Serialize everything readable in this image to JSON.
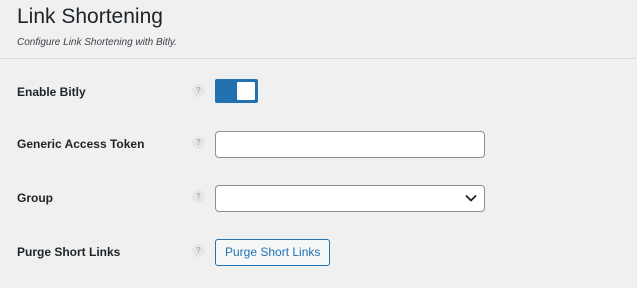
{
  "header": {
    "title": "Link Shortening",
    "description": "Configure Link Shortening with Bitly."
  },
  "help_glyph": "?",
  "settings": {
    "enable_bitly": {
      "label": "Enable Bitly",
      "enabled": true
    },
    "access_token": {
      "label": "Generic Access Token",
      "value": "",
      "placeholder": ""
    },
    "group": {
      "label": "Group",
      "selected": "",
      "icon": "chevron-down-icon"
    },
    "purge": {
      "label": "Purge Short Links",
      "button_label": "Purge Short Links"
    }
  },
  "colors": {
    "accent": "#2271b1",
    "background": "#f0f0f1",
    "text": "#1d2327",
    "border": "#8c8f94"
  }
}
